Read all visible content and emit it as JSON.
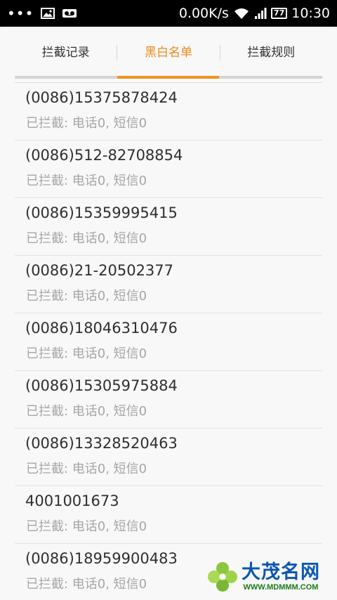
{
  "status_bar": {
    "speed": "0.00K/s",
    "battery": "77",
    "time": "10:30"
  },
  "tabs": [
    {
      "label": "拦截记录"
    },
    {
      "label": "黑白名单"
    },
    {
      "label": "拦截规则"
    }
  ],
  "active_tab": 1,
  "colors": {
    "accent": "#f0921e",
    "primary_text": "#2f2f2f",
    "secondary_text": "#a6a6a6"
  },
  "entries": [
    {
      "number": "(0086)15375878424",
      "detail": "已拦截: 电话0, 短信0"
    },
    {
      "number": "(0086)512-82708854",
      "detail": "已拦截: 电话0, 短信0"
    },
    {
      "number": "(0086)15359995415",
      "detail": "已拦截: 电话0, 短信0"
    },
    {
      "number": "(0086)21-20502377",
      "detail": "已拦截: 电话0, 短信0"
    },
    {
      "number": "(0086)18046310476",
      "detail": "已拦截: 电话0, 短信0"
    },
    {
      "number": "(0086)15305975884",
      "detail": "已拦截: 电话0, 短信0"
    },
    {
      "number": "(0086)13328520463",
      "detail": "已拦截: 电话0, 短信0"
    },
    {
      "number": "4001001673",
      "detail": "已拦截: 电话0, 短信0"
    },
    {
      "number": "(0086)18959900483",
      "detail": "已拦截: 电话0, 短信0"
    }
  ],
  "watermark": {
    "title": "大茂名网",
    "url": "WWW.MDMMM.COM"
  }
}
